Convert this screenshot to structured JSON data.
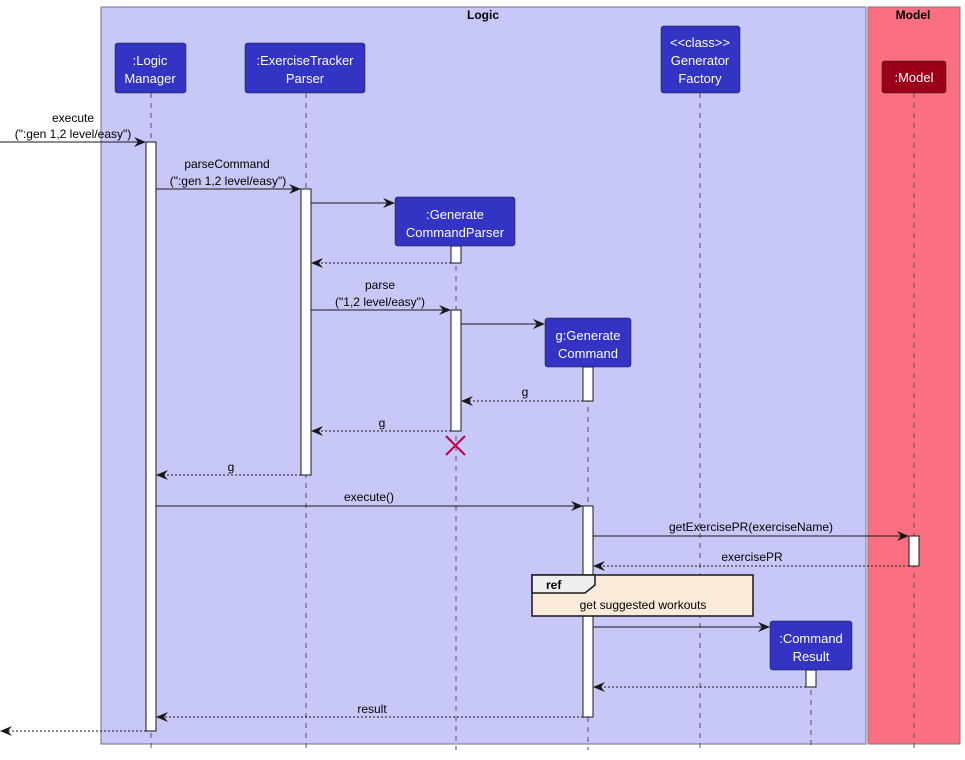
{
  "colors": {
    "logic_box_fill": "#C8C8F8",
    "model_box_fill": "#FB7081",
    "participant_fill": "#3333C4",
    "model_participant_fill": "#9A0017",
    "ref_fill": "#FAEAD8",
    "destroy_color": "#C0004B"
  },
  "boxes": {
    "logic": {
      "title": "Logic"
    },
    "model": {
      "title": "Model"
    }
  },
  "participants": [
    {
      "id": "logic-manager",
      "lines": [
        ":Logic",
        "Manager"
      ]
    },
    {
      "id": "exercise-tracker-parser",
      "lines": [
        ":ExerciseTracker",
        "Parser"
      ]
    },
    {
      "id": "generate-command-parser",
      "lines": [
        ":Generate",
        "CommandParser"
      ]
    },
    {
      "id": "generate-command",
      "lines": [
        "g:Generate",
        "Command"
      ]
    },
    {
      "id": "generator-factory",
      "lines": [
        "<<class>>",
        "Generator",
        "Factory"
      ]
    },
    {
      "id": "command-result",
      "lines": [
        ":Command",
        "Result"
      ]
    },
    {
      "id": "model",
      "lines": [
        ":Model"
      ]
    }
  ],
  "messages": [
    {
      "id": "execute-call",
      "from": "external",
      "to": "logic-manager",
      "type": "sync",
      "lines": [
        "execute",
        "(\":gen 1,2 level/easy\")"
      ]
    },
    {
      "id": "parse-command-call",
      "from": "logic-manager",
      "to": "exercise-tracker-parser",
      "type": "sync",
      "lines": [
        "parseCommand",
        "(\":gen 1,2 level/easy\")"
      ]
    },
    {
      "id": "create-parser",
      "from": "exercise-tracker-parser",
      "to": "generate-command-parser",
      "type": "create",
      "lines": []
    },
    {
      "id": "parser-return",
      "from": "generate-command-parser",
      "to": "exercise-tracker-parser",
      "type": "return",
      "lines": []
    },
    {
      "id": "parse-call",
      "from": "exercise-tracker-parser",
      "to": "generate-command-parser",
      "type": "sync",
      "lines": [
        "parse",
        "(\"1,2 level/easy\")"
      ]
    },
    {
      "id": "create-command",
      "from": "generate-command-parser",
      "to": "generate-command",
      "type": "create",
      "lines": []
    },
    {
      "id": "command-return-g",
      "from": "generate-command",
      "to": "generate-command-parser",
      "type": "return",
      "lines": [
        "g"
      ]
    },
    {
      "id": "parse-return-g",
      "from": "generate-command-parser",
      "to": "exercise-tracker-parser",
      "type": "return",
      "lines": [
        "g"
      ]
    },
    {
      "id": "parse-command-return-g",
      "from": "exercise-tracker-parser",
      "to": "logic-manager",
      "type": "return",
      "lines": [
        "g"
      ]
    },
    {
      "id": "execute-command-call",
      "from": "logic-manager",
      "to": "generate-command",
      "type": "sync",
      "lines": [
        "execute()"
      ]
    },
    {
      "id": "get-exercise-pr-call",
      "from": "generate-command",
      "to": "model",
      "type": "sync",
      "lines": [
        "getExercisePR(exerciseName)"
      ]
    },
    {
      "id": "exercise-pr-return",
      "from": "model",
      "to": "generate-command",
      "type": "return",
      "lines": [
        "exercisePR"
      ]
    },
    {
      "id": "create-command-result",
      "from": "generate-command",
      "to": "command-result",
      "type": "create",
      "lines": []
    },
    {
      "id": "command-result-return",
      "from": "command-result",
      "to": "generate-command",
      "type": "return",
      "lines": []
    },
    {
      "id": "result-return",
      "from": "generate-command",
      "to": "logic-manager",
      "type": "return",
      "lines": [
        "result"
      ]
    },
    {
      "id": "final-return",
      "from": "logic-manager",
      "to": "external",
      "type": "return",
      "lines": []
    }
  ],
  "ref": {
    "tag": "ref",
    "text": "get suggested workouts"
  },
  "destroyed": [
    "generate-command-parser"
  ]
}
